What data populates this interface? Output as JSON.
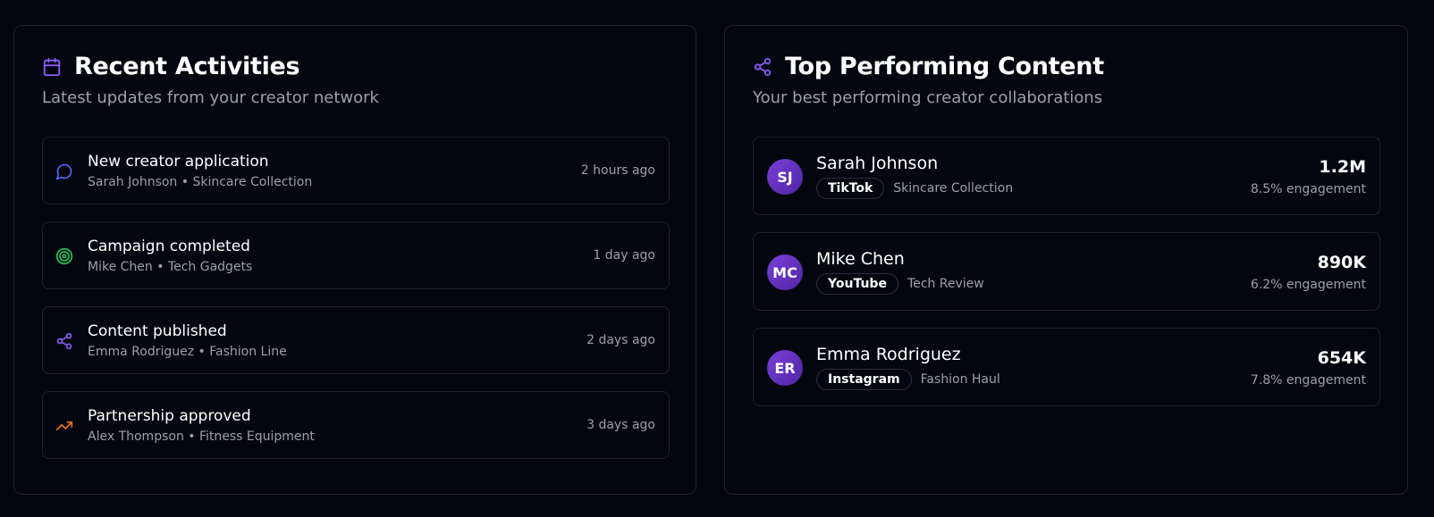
{
  "colors": {
    "background": "#03060f",
    "card_border": "#1e2230",
    "accent_purple": "#8b5cf6",
    "blue_icon": "#4f6bf6",
    "green_icon": "#22c55e",
    "orange_icon": "#f97316",
    "muted_text": "#9aa0ab"
  },
  "recent": {
    "icon": "calendar-icon",
    "title": "Recent Activities",
    "subtitle": "Latest updates from your creator network",
    "items": [
      {
        "icon": "message-icon",
        "title": "New creator application",
        "meta": "Sarah Johnson • Skincare Collection",
        "time": "2 hours ago"
      },
      {
        "icon": "target-icon",
        "title": "Campaign completed",
        "meta": "Mike Chen • Tech Gadgets",
        "time": "1 day ago"
      },
      {
        "icon": "share-icon",
        "title": "Content published",
        "meta": "Emma Rodriguez • Fashion Line",
        "time": "2 days ago"
      },
      {
        "icon": "trending-up-icon",
        "title": "Partnership approved",
        "meta": "Alex Thompson • Fitness Equipment",
        "time": "3 days ago"
      }
    ]
  },
  "top": {
    "icon": "share-icon",
    "title": "Top Performing Content",
    "subtitle": "Your best performing creator collaborations",
    "items": [
      {
        "initials": "SJ",
        "name": "Sarah Johnson",
        "platform": "TikTok",
        "campaign": "Skincare Collection",
        "views": "1.2M",
        "engagement": "8.5% engagement"
      },
      {
        "initials": "MC",
        "name": "Mike Chen",
        "platform": "YouTube",
        "campaign": "Tech Review",
        "views": "890K",
        "engagement": "6.2% engagement"
      },
      {
        "initials": "ER",
        "name": "Emma Rodriguez",
        "platform": "Instagram",
        "campaign": "Fashion Haul",
        "views": "654K",
        "engagement": "7.8% engagement"
      }
    ]
  }
}
